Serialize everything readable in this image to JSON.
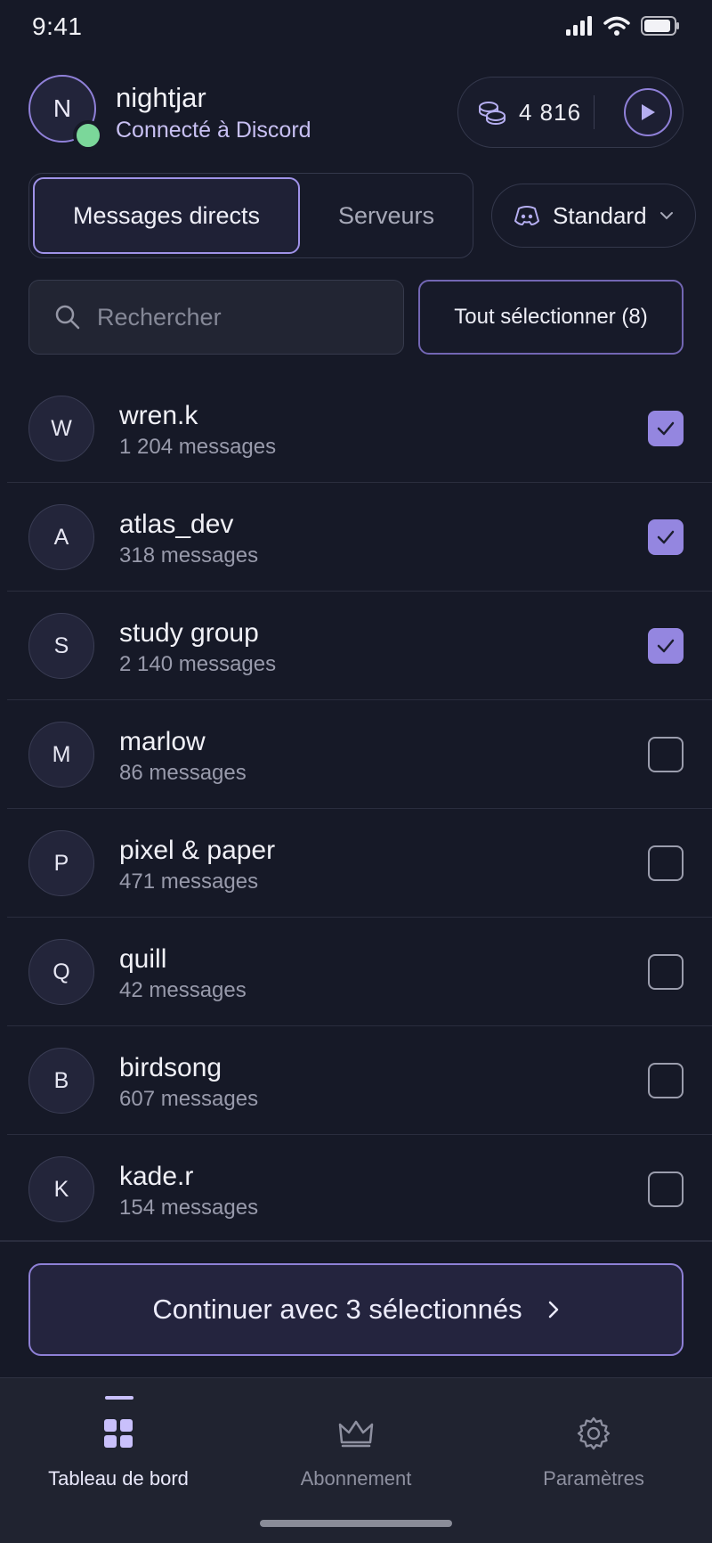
{
  "status_bar": {
    "time": "9:41"
  },
  "profile": {
    "initial": "N",
    "username": "nightjar",
    "connection": "Connecté à Discord"
  },
  "credits": {
    "value": "4 816",
    "icon": "coins-icon"
  },
  "tabs": [
    {
      "label": "Messages directs",
      "active": true
    },
    {
      "label": "Serveurs",
      "active": false
    }
  ],
  "mode_select": {
    "label": "Standard",
    "icon": "discord-icon"
  },
  "search": {
    "placeholder": "Rechercher",
    "value": ""
  },
  "select_all": {
    "label": "Tout sélectionner (8)"
  },
  "conversations": [
    {
      "initial": "W",
      "name": "wren.k",
      "count": "1 204 messages",
      "checked": true
    },
    {
      "initial": "A",
      "name": "atlas_dev",
      "count": "318 messages",
      "checked": true
    },
    {
      "initial": "S",
      "name": "study group",
      "count": "2 140 messages",
      "checked": true
    },
    {
      "initial": "M",
      "name": "marlow",
      "count": "86 messages",
      "checked": false
    },
    {
      "initial": "P",
      "name": "pixel & paper",
      "count": "471 messages",
      "checked": false
    },
    {
      "initial": "Q",
      "name": "quill",
      "count": "42 messages",
      "checked": false
    },
    {
      "initial": "B",
      "name": "birdsong",
      "count": "607 messages",
      "checked": false
    },
    {
      "initial": "K",
      "name": "kade.r",
      "count": "154 messages",
      "checked": false
    }
  ],
  "continue_button": {
    "label": "Continuer avec 3 sélectionnés"
  },
  "bottom_nav": [
    {
      "label": "Tableau de bord",
      "icon": "dashboard-icon",
      "active": true
    },
    {
      "label": "Abonnement",
      "icon": "crown-icon",
      "active": false
    },
    {
      "label": "Paramètres",
      "icon": "gear-icon",
      "active": false
    }
  ],
  "colors": {
    "background": "#161927",
    "accent": "#9486e0",
    "online": "#7bd79a"
  }
}
